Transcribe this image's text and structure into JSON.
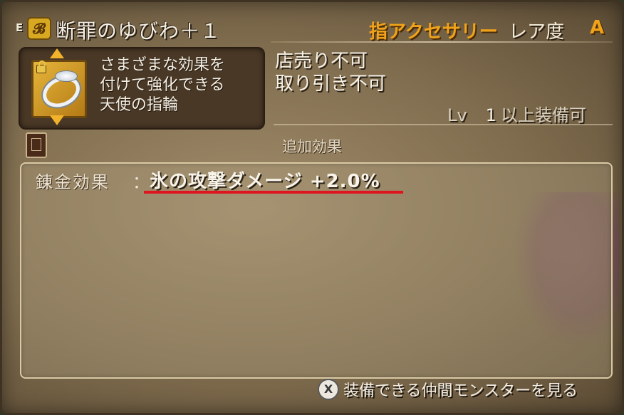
{
  "header": {
    "equip_badge": "E",
    "ring_type_icon_glyph": "𝓑",
    "item_name": "断罪のゆびわ＋１",
    "category": "指アクセサリー",
    "rarity_label": "レア度",
    "rarity_value": "A"
  },
  "description": {
    "lines": "さまざまな効果を\n付けて強化できる\n天使の指輪"
  },
  "trade": {
    "lines": "店売り不可\n取り引き不可"
  },
  "level_requirement": {
    "lv_label": "Lv",
    "level": "1",
    "suffix": "以上装備可"
  },
  "additional_effects": {
    "title": "追加効果",
    "alchemy_label": "錬金効果",
    "colon": "：",
    "alchemy_value": "氷の攻撃ダメージ +2.0%"
  },
  "footer": {
    "button_glyph": "X",
    "hint": "装備できる仲間モンスターを見る"
  },
  "colors": {
    "accent_orange": "#f0a21a",
    "highlight_underline": "#e0141e"
  },
  "icons": [
    "ring-type-icon",
    "ring-item-icon",
    "lock-icon",
    "book-icon",
    "x-button-icon",
    "up-arrow-icon",
    "down-arrow-icon"
  ]
}
